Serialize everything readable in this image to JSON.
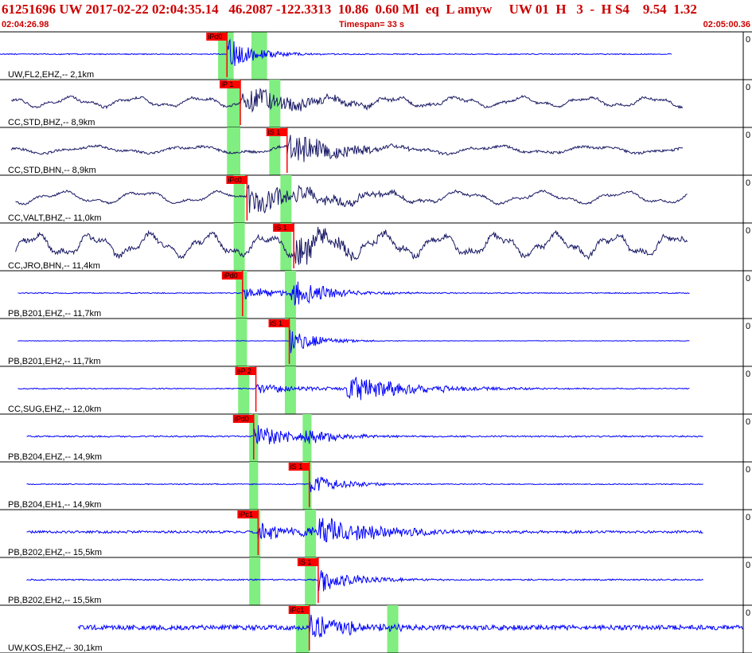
{
  "header": {
    "title": "61251696 UW 2017-02-22 02:04:35.14   46.2087 -122.3313  10.86  0.60 Ml  eq  L amyw     UW 01  H   3  -  H S4    9.54  1.32",
    "time_start": "02:04:26.98",
    "timespan": "Timespan=  33 s",
    "time_end": "02:05:00.36"
  },
  "colors": {
    "header_text": "#cc0000",
    "trace_blue": "#0000ff",
    "trace_navy": "#1a1a66",
    "pick": "#ff0000",
    "window_green": "#80ee80",
    "separator": "#000000"
  },
  "chart_data": {
    "type": "line",
    "title": "61251696 UW 2017-02-22 02:04:35.14   46.2087 -122.3313  10.86  0.60 Ml  eq  L amyw     UW 01  H   3  -  H S4    9.54  1.32",
    "xlabel": "Timespan=  33 s",
    "x_start": "02:04:26.98",
    "x_end": "02:05:00.36",
    "xlim": [
      0,
      33.4
    ],
    "x_unit": "s",
    "scale_label": "0",
    "series": [
      {
        "name": "UW,FL2,EHZ,-- 2,1km",
        "color": "#0000ff",
        "style": "spiky",
        "start": 0,
        "end": 30.2,
        "noise": 0.02,
        "event": 10.2,
        "amp": 0.7,
        "decay": 1.2,
        "pick": {
          "label": "iPd0",
          "t": 10.2
        },
        "windows": [
          [
            9.8,
            10.5
          ],
          [
            11.3,
            12.0
          ]
        ]
      },
      {
        "name": "CC,STD,BHZ,-- 8,9km",
        "color": "#1a1a66",
        "style": "wavy",
        "start": 0.5,
        "end": 30.7,
        "wave_amp": 0.16,
        "wave_period": 2.9,
        "noise": 0.05,
        "event": 10.8,
        "amp": 0.55,
        "decay": 3.0,
        "pick": {
          "label": "iP 1",
          "t": 10.8
        },
        "windows": [
          [
            10.2,
            10.8
          ],
          [
            12.1,
            12.6
          ]
        ]
      },
      {
        "name": "CC,STD,BHN,-- 8,9km",
        "color": "#1a1a66",
        "style": "wavy",
        "start": 0.5,
        "end": 30.7,
        "wave_amp": 0.12,
        "wave_period": 4.5,
        "noise": 0.05,
        "event": 12.9,
        "amp": 0.75,
        "decay": 2.2,
        "pick": {
          "label": "iS 1",
          "t": 12.9
        },
        "windows": [
          [
            10.2,
            10.8
          ],
          [
            12.1,
            12.6
          ]
        ]
      },
      {
        "name": "CC,VALT,BHZ,-- 11,0km",
        "color": "#1a1a66",
        "style": "wavy",
        "start": 0.7,
        "end": 30.9,
        "wave_amp": 0.2,
        "wave_period": 3.6,
        "noise": 0.04,
        "event": 11.1,
        "amp": 0.6,
        "decay": 3.5,
        "pick": {
          "label": "iPc0",
          "t": 11.1
        },
        "windows": [
          [
            10.5,
            11.0
          ],
          [
            12.6,
            13.1
          ]
        ]
      },
      {
        "name": "CC,JRO,BHN,-- 11,4km",
        "color": "#1a1a66",
        "style": "wavy",
        "start": 0.7,
        "end": 30.9,
        "wave_amp": 0.36,
        "wave_period": 2.6,
        "noise": 0.1,
        "event": 13.2,
        "amp": 0.7,
        "decay": 2.0,
        "pick": {
          "label": "iS 1",
          "t": 13.2
        },
        "windows": [
          [
            10.5,
            11.0
          ],
          [
            12.6,
            13.1
          ]
        ]
      },
      {
        "name": "PB,B201,EHZ,-- 11,7km",
        "color": "#0000ff",
        "style": "spiky",
        "start": 0.8,
        "end": 31.0,
        "noise": 0.02,
        "event": 10.9,
        "amp": 0.3,
        "decay": 1.8,
        "event2": 13.1,
        "amp2": 0.55,
        "pick": {
          "label": "iPd0",
          "t": 10.9
        },
        "windows": [
          [
            10.6,
            11.1
          ],
          [
            12.8,
            13.3
          ]
        ]
      },
      {
        "name": "PB,B201,EH2,-- 11,7km",
        "color": "#0000ff",
        "style": "spiky",
        "start": 0.8,
        "end": 31.0,
        "noise": 0.01,
        "event": 13.0,
        "amp": 0.55,
        "decay": 1.2,
        "pick": {
          "label": "iS 1",
          "t": 13.0
        },
        "windows": [
          [
            10.6,
            11.1
          ],
          [
            12.8,
            13.3
          ]
        ]
      },
      {
        "name": "CC,SUG,EHZ,-- 12,0km",
        "color": "#0000ff",
        "style": "spiky",
        "start": 0.8,
        "end": 31.0,
        "noise": 0.02,
        "event": 11.5,
        "amp": 0.2,
        "decay": 3.0,
        "event2": 15.6,
        "amp2": 0.55,
        "pick": {
          "label": "eP 2",
          "t": 11.5
        },
        "windows": [
          [
            10.7,
            11.2
          ],
          [
            12.8,
            13.3
          ]
        ]
      },
      {
        "name": "PB,B204,EHZ,-- 14,9km",
        "color": "#0000ff",
        "style": "spiky",
        "start": 1.2,
        "end": 31.6,
        "noise": 0.03,
        "event": 11.4,
        "amp": 0.55,
        "decay": 1.6,
        "event2": 13.7,
        "amp2": 0.3,
        "pick": {
          "label": "iPd0",
          "t": 11.4
        },
        "windows": [
          [
            11.2,
            11.6
          ],
          [
            13.6,
            14.0
          ]
        ]
      },
      {
        "name": "PB,B204,EH1,-- 14,9km",
        "color": "#0000ff",
        "style": "spiky",
        "start": 1.2,
        "end": 31.6,
        "noise": 0.02,
        "event": 13.9,
        "amp": 0.45,
        "decay": 1.4,
        "pick": {
          "label": "iS 1",
          "t": 13.9
        },
        "windows": [
          [
            11.2,
            11.6
          ],
          [
            13.6,
            14.0
          ]
        ]
      },
      {
        "name": "PB,B202,EHZ,-- 15,5km",
        "color": "#0000ff",
        "style": "spiky",
        "start": 1.2,
        "end": 31.6,
        "noise": 0.05,
        "event": 11.6,
        "amp": 0.35,
        "decay": 3.0,
        "event2": 14.3,
        "amp2": 0.6,
        "pick": {
          "label": "iPc1",
          "t": 11.6
        },
        "windows": [
          [
            11.2,
            11.7
          ],
          [
            13.7,
            14.2
          ]
        ]
      },
      {
        "name": "PB,B202,EH2,-- 15,5km",
        "color": "#0000ff",
        "style": "spiky",
        "start": 1.2,
        "end": 31.6,
        "noise": 0.03,
        "event": 14.3,
        "amp": 0.6,
        "decay": 1.5,
        "pick": {
          "label": "iS 1",
          "t": 14.3
        },
        "windows": [
          [
            11.2,
            11.7
          ],
          [
            13.7,
            14.2
          ]
        ]
      },
      {
        "name": "UW,KOS,EHZ,-- 30,1km",
        "color": "#0000ff",
        "style": "spiky",
        "start": 3.5,
        "end": 33.4,
        "noise": 0.1,
        "event": 13.9,
        "amp": 0.6,
        "decay": 2.0,
        "pick": {
          "label": "iPc1",
          "t": 13.9
        },
        "windows": [
          [
            13.3,
            13.9
          ],
          [
            17.4,
            17.9
          ]
        ]
      }
    ]
  }
}
